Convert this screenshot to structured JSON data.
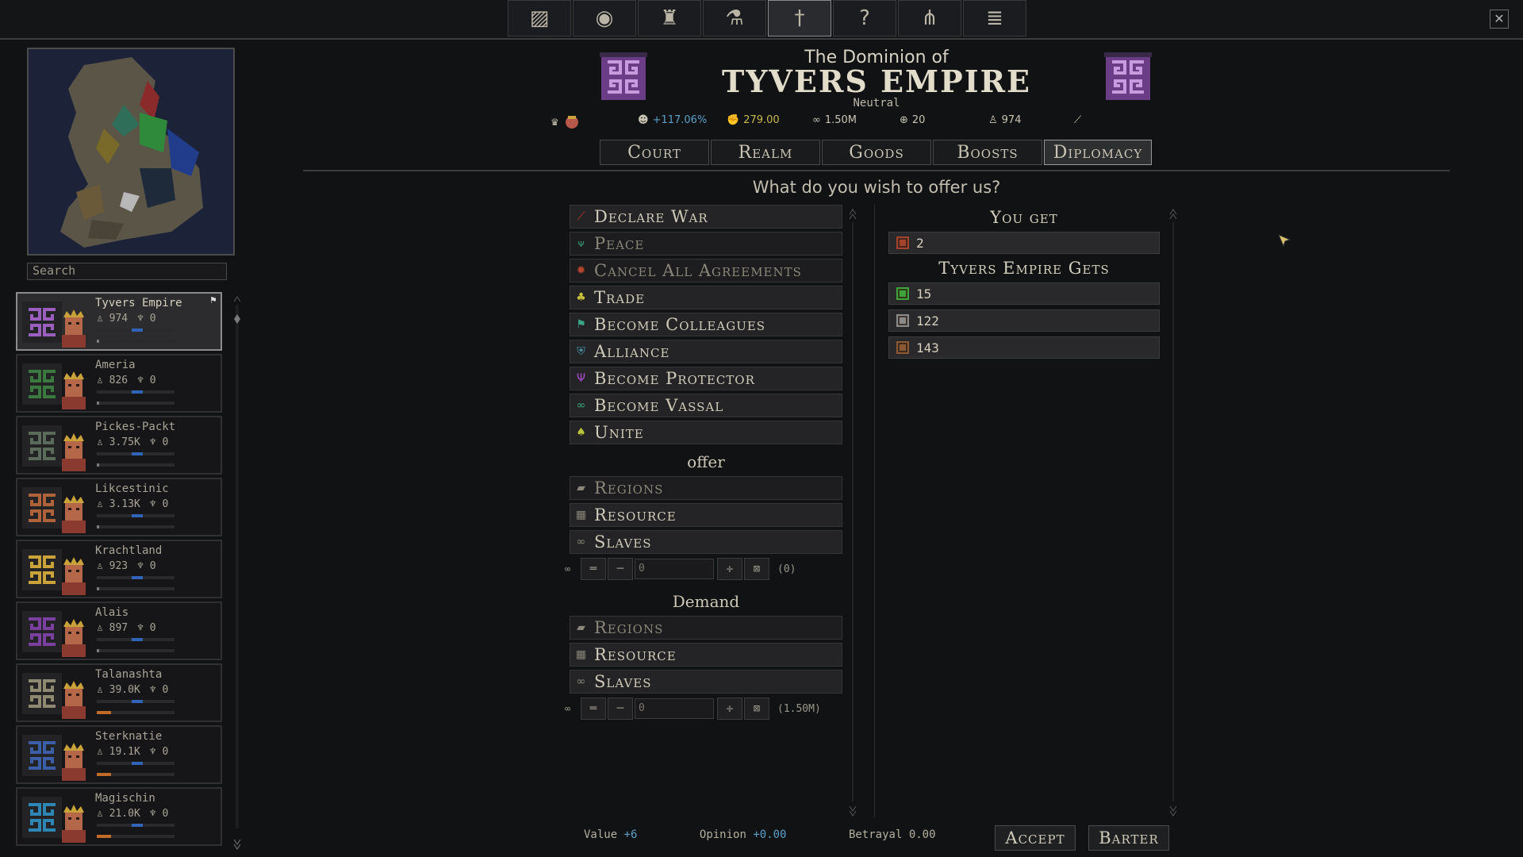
{
  "toolbar": {
    "buttons": [
      {
        "name": "ledger-icon",
        "glyph": "▨"
      },
      {
        "name": "coin-icon",
        "glyph": "◉"
      },
      {
        "name": "people-icon",
        "glyph": "♜"
      },
      {
        "name": "flask-icon",
        "glyph": "⚗"
      },
      {
        "name": "diplomacy-icon",
        "glyph": "†"
      },
      {
        "name": "help-icon",
        "glyph": "?"
      },
      {
        "name": "tree-icon",
        "glyph": "⋔"
      },
      {
        "name": "list-icon",
        "glyph": "≣"
      }
    ],
    "close_glyph": "✕"
  },
  "sidebar": {
    "search_placeholder": "Search",
    "factions": [
      {
        "name": "Tyvers Empire",
        "pop": "974",
        "faith": "0",
        "color": "#9b5fc0",
        "selected": true
      },
      {
        "name": "Ameria",
        "pop": "826",
        "faith": "0",
        "color": "#3b7a3e"
      },
      {
        "name": "Pickes-Packt",
        "pop": "3.75K",
        "faith": "0",
        "color": "#5b6b5b"
      },
      {
        "name": "Likcestinic",
        "pop": "3.13K",
        "faith": "0",
        "color": "#b0623a"
      },
      {
        "name": "Krachtland",
        "pop": "923",
        "faith": "0",
        "color": "#c9a23a"
      },
      {
        "name": "Alais",
        "pop": "897",
        "faith": "0",
        "color": "#7b3fa0"
      },
      {
        "name": "Talanashta",
        "pop": "39.0K",
        "faith": "0",
        "color": "#8e8a72"
      },
      {
        "name": "Sterknatie",
        "pop": "19.1K",
        "faith": "0",
        "color": "#3a5fa8"
      },
      {
        "name": "Magischin",
        "pop": "21.0K",
        "faith": "0",
        "color": "#2e86b5"
      }
    ]
  },
  "header": {
    "title_small": "The Dominion of",
    "title_big": "TYVERS EMPIRE",
    "stance": "Neutral",
    "stats": {
      "growth": "+117.06%",
      "coin": "279.00",
      "military": "1.50M",
      "regions": "20",
      "population": "974"
    }
  },
  "tabs": [
    {
      "label": "Court"
    },
    {
      "label": "Realm"
    },
    {
      "label": "Goods"
    },
    {
      "label": "Boosts"
    },
    {
      "label": "Diplomacy",
      "active": true
    }
  ],
  "prompt": "What do you wish to offer us?",
  "actions": [
    {
      "label": "Declare War",
      "icon": "sword-icon",
      "glyph": "⟋",
      "color": "#c0392b"
    },
    {
      "label": "Peace",
      "icon": "branch-icon",
      "glyph": "ψ",
      "color": "#3aa37a",
      "dim": true
    },
    {
      "label": "Cancel All Agreements",
      "icon": "cancel-icon",
      "glyph": "✹",
      "color": "#b5452e",
      "dim": true
    },
    {
      "label": "Trade",
      "icon": "trade-icon",
      "glyph": "♣",
      "color": "#c9c13a"
    },
    {
      "label": "Become Colleagues",
      "icon": "flag-icon",
      "glyph": "⚑",
      "color": "#3ba58c"
    },
    {
      "label": "Alliance",
      "icon": "shield-icon",
      "glyph": "⛨",
      "color": "#4a9bb4"
    },
    {
      "label": "Become Protector",
      "icon": "protector-icon",
      "glyph": "Ψ",
      "color": "#b04ad4"
    },
    {
      "label": "Become Vassal",
      "icon": "chain-icon",
      "glyph": "∞",
      "color": "#3ea87a"
    },
    {
      "label": "Unite",
      "icon": "unite-icon",
      "glyph": "♠",
      "color": "#b8c43a"
    }
  ],
  "offer": {
    "heading": "offer",
    "items": [
      {
        "label": "Regions",
        "icon": "region-icon",
        "glyph": "▰",
        "dim": true
      },
      {
        "label": "Resource",
        "icon": "resource-icon",
        "glyph": "▦"
      },
      {
        "label": "Slaves",
        "icon": "slave-icon",
        "glyph": "∞"
      }
    ],
    "qty_value": "0",
    "qty_max": "(0)"
  },
  "demand": {
    "heading": "Demand",
    "items": [
      {
        "label": "Regions",
        "icon": "region-icon",
        "glyph": "▰",
        "dim": true
      },
      {
        "label": "Resource",
        "icon": "resource-icon",
        "glyph": "▦"
      },
      {
        "label": "Slaves",
        "icon": "slave-icon",
        "glyph": "∞"
      }
    ],
    "qty_value": "0",
    "qty_max": "(1.50M)"
  },
  "you_get": {
    "heading": "You get",
    "items": [
      {
        "value": "2",
        "icon": "crate-icon",
        "color": "#a0442e"
      }
    ]
  },
  "they_get": {
    "heading": "Tyvers Empire Gets",
    "items": [
      {
        "value": "15",
        "icon": "food-icon",
        "color": "#3fa33a"
      },
      {
        "value": "122",
        "icon": "stone-icon",
        "color": "#8a8a8a"
      },
      {
        "value": "143",
        "icon": "wood-icon",
        "color": "#8a5a36"
      }
    ]
  },
  "footer": {
    "value_label": "Value",
    "value": "+6",
    "opinion_label": "Opinion",
    "opinion": "+0.00",
    "betrayal_label": "Betrayal",
    "betrayal": "0.00",
    "accept": "Accept",
    "barter": "Barter"
  }
}
